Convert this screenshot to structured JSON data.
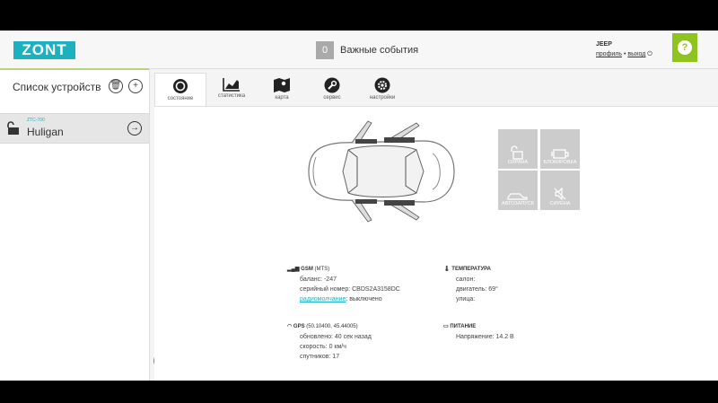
{
  "header": {
    "logo": "ZONT",
    "events_count": "0",
    "events_label": "Важные события",
    "user_name": "JEEP",
    "profile_link": "профиль",
    "separator": "•",
    "logout_link": "выход",
    "help_icon": "question-icon"
  },
  "sidebar": {
    "title": "Список устройств",
    "device": {
      "model": "ZTC-700",
      "name": "Huligan"
    }
  },
  "tabs": [
    {
      "label": "состояние",
      "icon": "record-icon"
    },
    {
      "label": "статистика",
      "icon": "chart-icon"
    },
    {
      "label": "карта",
      "icon": "map-icon"
    },
    {
      "label": "сервис",
      "icon": "wrench-icon"
    },
    {
      "label": "настройки",
      "icon": "gear-icon"
    }
  ],
  "controls": [
    {
      "label": "ОХРАНА",
      "icon": "unlock-icon"
    },
    {
      "label": "БЛОКИРОВКА",
      "icon": "engine-icon"
    },
    {
      "label": "АВТОЗАПУСК",
      "icon": "car-start-icon"
    },
    {
      "label": "СИРЕНА",
      "icon": "siren-off-icon"
    }
  ],
  "gsm": {
    "title": "GSM",
    "operator": "(MTS)",
    "balance": "баланс: -247",
    "serial": "серийный номер: CBDS2A3158DC",
    "radio_link": "радиомолчание",
    "radio_value": ": выключено"
  },
  "gps": {
    "title": "GPS",
    "coords": "(50.10400, 45.44005)",
    "updated": "обновлено: 40 сек назад",
    "speed": "скорость: 0 км/ч",
    "sats": "спутников: 17"
  },
  "temperature": {
    "title": "ТЕМПЕРАТУРА",
    "cabin": "салон:",
    "engine": "двигатель: 69°",
    "street": "улица:"
  },
  "power": {
    "title": "ПИТАНИЕ",
    "voltage": "Напряжение: 14.2 В"
  },
  "colors": {
    "accent": "#1db0bf",
    "help": "#8fc31f",
    "control": "#cccccc"
  }
}
